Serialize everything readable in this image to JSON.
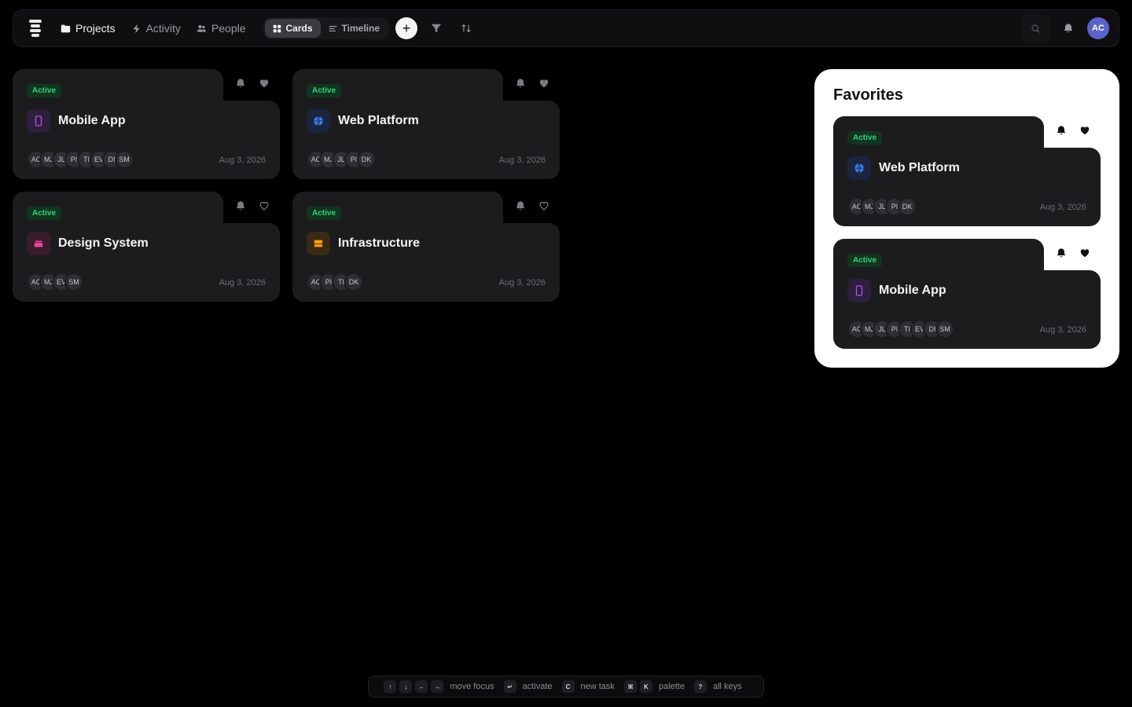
{
  "nav": {
    "items": [
      {
        "label": "Projects",
        "icon": "folder-icon",
        "active": true
      },
      {
        "label": "Activity",
        "icon": "bolt-icon",
        "active": false
      },
      {
        "label": "People",
        "icon": "people-icon",
        "active": false
      }
    ],
    "views": [
      {
        "label": "Cards",
        "icon": "grid-icon",
        "active": true
      },
      {
        "label": "Timeline",
        "icon": "lines-icon",
        "active": false
      }
    ],
    "add_label": "+",
    "user_initials": "AC"
  },
  "projects": [
    {
      "status": "Active",
      "title": "Mobile App",
      "icon": "phone-icon",
      "date": "Aug 3, 2026",
      "favorited": true,
      "members": [
        "AC",
        "MJ",
        "JL",
        "PI",
        "TI",
        "EV",
        "DI",
        "SM"
      ]
    },
    {
      "status": "Active",
      "title": "Web Platform",
      "icon": "globe-icon",
      "date": "Aug 3, 2026",
      "favorited": true,
      "members": [
        "AC",
        "MJ",
        "JL",
        "PI",
        "DK"
      ]
    },
    {
      "status": "Active",
      "title": "Design System",
      "icon": "layers-icon",
      "date": "Aug 3, 2026",
      "favorited": false,
      "members": [
        "AC",
        "MJ",
        "EV",
        "SM"
      ]
    },
    {
      "status": "Active",
      "title": "Infrastructure",
      "icon": "server-icon",
      "date": "Aug 3, 2026",
      "favorited": false,
      "members": [
        "AC",
        "PI",
        "TI",
        "DK"
      ]
    }
  ],
  "favorites": {
    "title": "Favorites",
    "items": [
      {
        "status": "Active",
        "title": "Web Platform",
        "icon": "globe-icon",
        "date": "Aug 3, 2026",
        "members": [
          "AC",
          "MJ",
          "JL",
          "PI",
          "DK"
        ]
      },
      {
        "status": "Active",
        "title": "Mobile App",
        "icon": "phone-icon",
        "date": "Aug 3, 2026",
        "members": [
          "AC",
          "MJ",
          "JL",
          "PI",
          "TI",
          "EV",
          "DI",
          "SM"
        ]
      }
    ]
  },
  "shortcuts": [
    {
      "keys": [
        "↑",
        "↓",
        "←",
        "→"
      ],
      "label": "move focus"
    },
    {
      "keys": [
        "↵"
      ],
      "label": "activate"
    },
    {
      "keys": [
        "C"
      ],
      "label": "new task"
    },
    {
      "keys": [
        "⌘",
        "K"
      ],
      "label": "palette"
    },
    {
      "keys": [
        "?"
      ],
      "label": "all keys"
    }
  ],
  "colors": {
    "accent": "#5b63c9",
    "active_badge": "#35d07f",
    "phone": "#a855f7",
    "globe": "#3b82f6",
    "layers": "#ec4899",
    "server": "#f59e0b"
  }
}
